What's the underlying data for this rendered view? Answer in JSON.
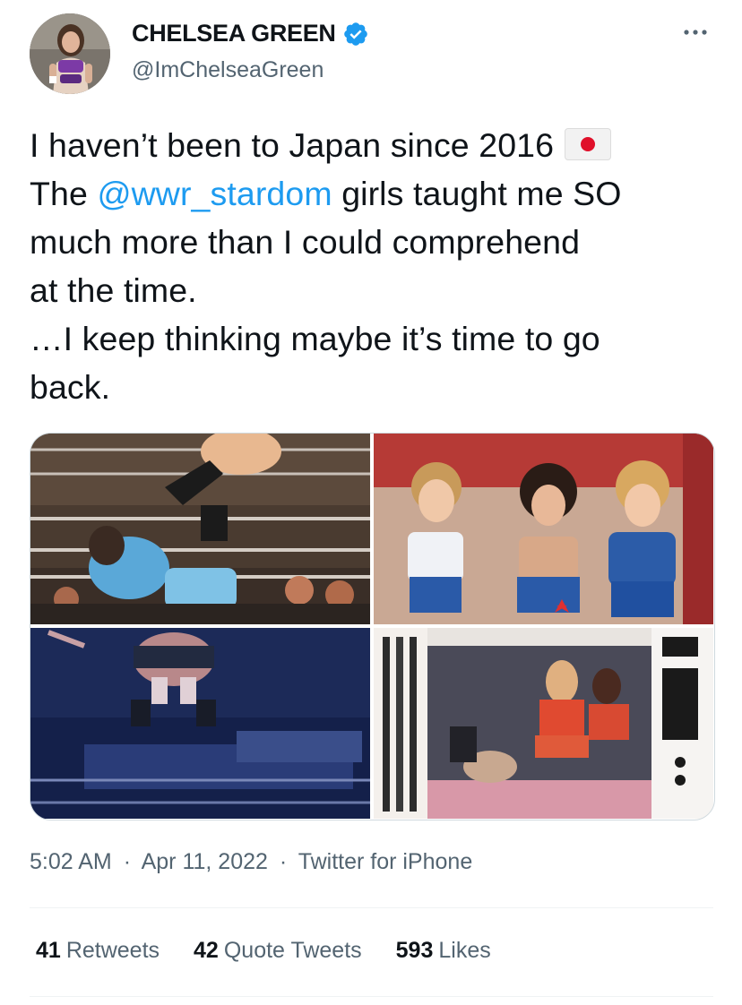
{
  "author": {
    "display_name": "CHELSEA GREEN",
    "handle": "@ImChelseaGreen",
    "verified": true,
    "avatar_icon": "profile-photo"
  },
  "tweet": {
    "line1": "I haven’t been to Japan since 2016",
    "flag_icon": "japan-flag-emoji",
    "line2_prefix": "The ",
    "mention": "@wwr_stardom",
    "line2_suffix": " girls taught me SO",
    "line3": "much more than I could comprehend",
    "line4": "at the time.",
    "line5": "…I keep thinking maybe it’s time to go",
    "line6": "back."
  },
  "media": {
    "photos": [
      "wrestling-ring-action-photo",
      "group-photo-wrestlers",
      "aerial-dive-photo",
      "magazine-page-photo"
    ]
  },
  "meta": {
    "time": "5:02 AM",
    "date": "Apr 11, 2022",
    "source": "Twitter for iPhone",
    "separator": "·"
  },
  "stats": {
    "retweets_count": "41",
    "retweets_label": "Retweets",
    "quotes_count": "42",
    "quotes_label": "Quote Tweets",
    "likes_count": "593",
    "likes_label": "Likes"
  },
  "colors": {
    "link": "#1d9bf0",
    "secondary_text": "#536471",
    "primary_text": "#0f1419",
    "verified": "#1d9bf0"
  }
}
